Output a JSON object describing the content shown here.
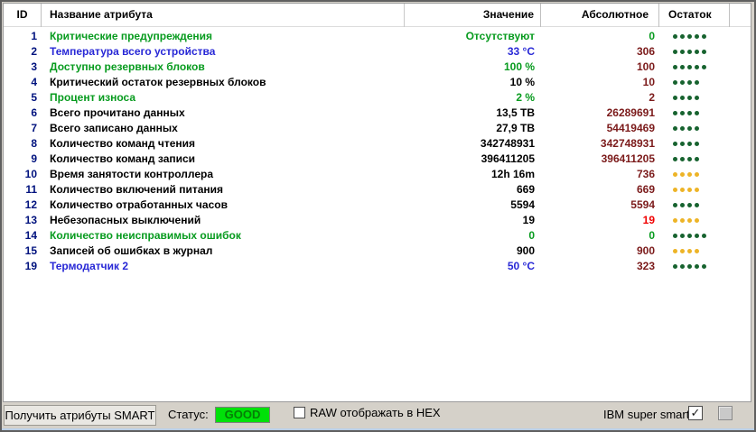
{
  "table": {
    "headers": {
      "id": "ID",
      "name": "Название атрибута",
      "value": "Значение",
      "absolute": "Абсолютное",
      "remainder": "Остаток"
    },
    "rows": [
      {
        "id": "1",
        "name": "Критические предупреждения",
        "name_color": "green",
        "value": "Отсутствуют",
        "value_color": "green",
        "absolute": "0",
        "absolute_color": "green",
        "dots": 5,
        "dot_color": "green"
      },
      {
        "id": "2",
        "name": "Температура всего устройства",
        "name_color": "blue",
        "value": "33 °C",
        "value_color": "blue",
        "absolute": "306",
        "absolute_color": "maroon",
        "dots": 5,
        "dot_color": "green"
      },
      {
        "id": "3",
        "name": "Доступно резервных блоков",
        "name_color": "green",
        "value": "100 %",
        "value_color": "green",
        "absolute": "100",
        "absolute_color": "maroon",
        "dots": 5,
        "dot_color": "green"
      },
      {
        "id": "4",
        "name": "Критический остаток резервных блоков",
        "name_color": "black",
        "value": "10 %",
        "value_color": "black",
        "absolute": "10",
        "absolute_color": "maroon",
        "dots": 4,
        "dot_color": "green"
      },
      {
        "id": "5",
        "name": "Процент износа",
        "name_color": "green",
        "value": "2 %",
        "value_color": "green",
        "absolute": "2",
        "absolute_color": "maroon",
        "dots": 4,
        "dot_color": "green"
      },
      {
        "id": "6",
        "name": "Всего прочитано данных",
        "name_color": "black",
        "value": "13,5 TB",
        "value_color": "black",
        "absolute": "26289691",
        "absolute_color": "maroon",
        "dots": 4,
        "dot_color": "green"
      },
      {
        "id": "7",
        "name": "Всего записано данных",
        "name_color": "black",
        "value": "27,9 TB",
        "value_color": "black",
        "absolute": "54419469",
        "absolute_color": "maroon",
        "dots": 4,
        "dot_color": "green"
      },
      {
        "id": "8",
        "name": "Количество команд чтения",
        "name_color": "black",
        "value": "342748931",
        "value_color": "black",
        "absolute": "342748931",
        "absolute_color": "maroon",
        "dots": 4,
        "dot_color": "green"
      },
      {
        "id": "9",
        "name": "Количество команд записи",
        "name_color": "black",
        "value": "396411205",
        "value_color": "black",
        "absolute": "396411205",
        "absolute_color": "maroon",
        "dots": 4,
        "dot_color": "green"
      },
      {
        "id": "10",
        "name": "Время занятости контроллера",
        "name_color": "black",
        "value": "12h 16m",
        "value_color": "black",
        "absolute": "736",
        "absolute_color": "maroon",
        "dots": 4,
        "dot_color": "yellow"
      },
      {
        "id": "11",
        "name": "Количество включений питания",
        "name_color": "black",
        "value": "669",
        "value_color": "black",
        "absolute": "669",
        "absolute_color": "maroon",
        "dots": 4,
        "dot_color": "yellow"
      },
      {
        "id": "12",
        "name": "Количество отработанных часов",
        "name_color": "black",
        "value": "5594",
        "value_color": "black",
        "absolute": "5594",
        "absolute_color": "maroon",
        "dots": 4,
        "dot_color": "green"
      },
      {
        "id": "13",
        "name": "Небезопасных выключений",
        "name_color": "black",
        "value": "19",
        "value_color": "black",
        "absolute": "19",
        "absolute_color": "red",
        "dots": 4,
        "dot_color": "yellow"
      },
      {
        "id": "14",
        "name": "Количество неисправимых ошибок",
        "name_color": "green",
        "value": "0",
        "value_color": "green",
        "absolute": "0",
        "absolute_color": "green",
        "dots": 5,
        "dot_color": "green"
      },
      {
        "id": "15",
        "name": "Записей об ошибках в журнал",
        "name_color": "black",
        "value": "900",
        "value_color": "black",
        "absolute": "900",
        "absolute_color": "maroon",
        "dots": 4,
        "dot_color": "yellow"
      },
      {
        "id": "19",
        "name": "Термодатчик 2",
        "name_color": "blue",
        "value": "50 °C",
        "value_color": "blue",
        "absolute": "323",
        "absolute_color": "maroon",
        "dots": 5,
        "dot_color": "green"
      }
    ]
  },
  "footer": {
    "get_button": "Получить атрибуты SMART",
    "status_label": "Статус:",
    "status_value": "GOOD",
    "raw_hex_label": "RAW отображать в HEX",
    "raw_hex_checked": false,
    "ibm_label": "IBM super smart:",
    "ibm_checked": true
  },
  "colors": {
    "green": "#079B1E",
    "blue": "#2828D6",
    "black": "#000000",
    "maroon": "#7B1A1A",
    "red": "#F00000",
    "navy": "#00127E",
    "dot_green": "#17632F",
    "dot_yellow": "#EDB427",
    "status_bg": "#00E109",
    "status_text": "#067F06"
  }
}
